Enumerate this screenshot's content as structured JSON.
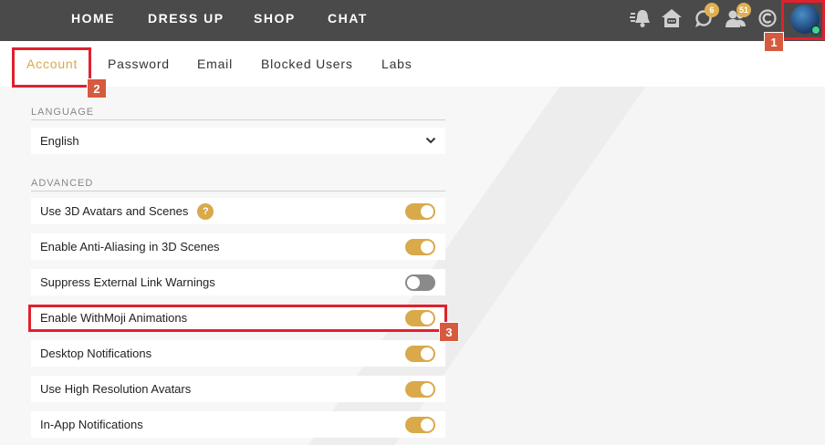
{
  "nav": {
    "home": "HOME",
    "dress_up": "DRESS UP",
    "shop": "SHOP",
    "chat": "CHAT"
  },
  "header_icons": {
    "announcements": "megaphone-bell-icon",
    "home": "house-chat-icon",
    "messages": {
      "icon": "chat-bubble-icon",
      "badge": "6"
    },
    "friends": {
      "icon": "people-icon",
      "badge": "51"
    },
    "credits": "copyright-c-icon"
  },
  "tabs": [
    "Account",
    "Password",
    "Email",
    "Blocked Users",
    "Labs"
  ],
  "language": {
    "label": "LANGUAGE",
    "value": "English"
  },
  "advanced": {
    "label": "ADVANCED",
    "settings": [
      {
        "label": "Use 3D Avatars and Scenes",
        "on": true,
        "help": "?"
      },
      {
        "label": "Enable Anti-Aliasing in 3D Scenes",
        "on": true
      },
      {
        "label": "Suppress External Link Warnings",
        "on": false
      },
      {
        "label": "Enable WithMoji Animations",
        "on": true
      },
      {
        "label": "Desktop Notifications",
        "on": true
      },
      {
        "label": "Use High Resolution Avatars",
        "on": true
      },
      {
        "label": "In-App Notifications",
        "on": true
      }
    ]
  },
  "annotations": [
    "1",
    "2",
    "3"
  ],
  "colors": {
    "accent": "#d9a94a",
    "topbar": "#4a4a4a",
    "highlight": "#e0202e",
    "marker": "#d65a3e",
    "toggle_off": "#8a8a8a",
    "online": "#3fd48a"
  }
}
